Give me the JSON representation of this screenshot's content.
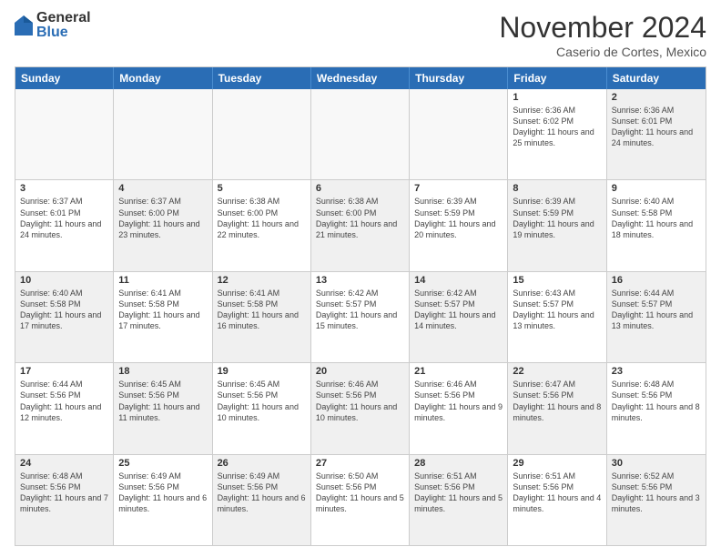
{
  "logo": {
    "general": "General",
    "blue": "Blue"
  },
  "header": {
    "title": "November 2024",
    "location": "Caserio de Cortes, Mexico"
  },
  "weekdays": [
    "Sunday",
    "Monday",
    "Tuesday",
    "Wednesday",
    "Thursday",
    "Friday",
    "Saturday"
  ],
  "rows": [
    [
      {
        "day": "",
        "info": "",
        "empty": true
      },
      {
        "day": "",
        "info": "",
        "empty": true
      },
      {
        "day": "",
        "info": "",
        "empty": true
      },
      {
        "day": "",
        "info": "",
        "empty": true
      },
      {
        "day": "",
        "info": "",
        "empty": true
      },
      {
        "day": "1",
        "info": "Sunrise: 6:36 AM\nSunset: 6:02 PM\nDaylight: 11 hours and 25 minutes.",
        "shade": false
      },
      {
        "day": "2",
        "info": "Sunrise: 6:36 AM\nSunset: 6:01 PM\nDaylight: 11 hours and 24 minutes.",
        "shade": true
      }
    ],
    [
      {
        "day": "3",
        "info": "Sunrise: 6:37 AM\nSunset: 6:01 PM\nDaylight: 11 hours and 24 minutes.",
        "shade": false
      },
      {
        "day": "4",
        "info": "Sunrise: 6:37 AM\nSunset: 6:00 PM\nDaylight: 11 hours and 23 minutes.",
        "shade": true
      },
      {
        "day": "5",
        "info": "Sunrise: 6:38 AM\nSunset: 6:00 PM\nDaylight: 11 hours and 22 minutes.",
        "shade": false
      },
      {
        "day": "6",
        "info": "Sunrise: 6:38 AM\nSunset: 6:00 PM\nDaylight: 11 hours and 21 minutes.",
        "shade": true
      },
      {
        "day": "7",
        "info": "Sunrise: 6:39 AM\nSunset: 5:59 PM\nDaylight: 11 hours and 20 minutes.",
        "shade": false
      },
      {
        "day": "8",
        "info": "Sunrise: 6:39 AM\nSunset: 5:59 PM\nDaylight: 11 hours and 19 minutes.",
        "shade": true
      },
      {
        "day": "9",
        "info": "Sunrise: 6:40 AM\nSunset: 5:58 PM\nDaylight: 11 hours and 18 minutes.",
        "shade": false
      }
    ],
    [
      {
        "day": "10",
        "info": "Sunrise: 6:40 AM\nSunset: 5:58 PM\nDaylight: 11 hours and 17 minutes.",
        "shade": true
      },
      {
        "day": "11",
        "info": "Sunrise: 6:41 AM\nSunset: 5:58 PM\nDaylight: 11 hours and 17 minutes.",
        "shade": false
      },
      {
        "day": "12",
        "info": "Sunrise: 6:41 AM\nSunset: 5:58 PM\nDaylight: 11 hours and 16 minutes.",
        "shade": true
      },
      {
        "day": "13",
        "info": "Sunrise: 6:42 AM\nSunset: 5:57 PM\nDaylight: 11 hours and 15 minutes.",
        "shade": false
      },
      {
        "day": "14",
        "info": "Sunrise: 6:42 AM\nSunset: 5:57 PM\nDaylight: 11 hours and 14 minutes.",
        "shade": true
      },
      {
        "day": "15",
        "info": "Sunrise: 6:43 AM\nSunset: 5:57 PM\nDaylight: 11 hours and 13 minutes.",
        "shade": false
      },
      {
        "day": "16",
        "info": "Sunrise: 6:44 AM\nSunset: 5:57 PM\nDaylight: 11 hours and 13 minutes.",
        "shade": true
      }
    ],
    [
      {
        "day": "17",
        "info": "Sunrise: 6:44 AM\nSunset: 5:56 PM\nDaylight: 11 hours and 12 minutes.",
        "shade": false
      },
      {
        "day": "18",
        "info": "Sunrise: 6:45 AM\nSunset: 5:56 PM\nDaylight: 11 hours and 11 minutes.",
        "shade": true
      },
      {
        "day": "19",
        "info": "Sunrise: 6:45 AM\nSunset: 5:56 PM\nDaylight: 11 hours and 10 minutes.",
        "shade": false
      },
      {
        "day": "20",
        "info": "Sunrise: 6:46 AM\nSunset: 5:56 PM\nDaylight: 11 hours and 10 minutes.",
        "shade": true
      },
      {
        "day": "21",
        "info": "Sunrise: 6:46 AM\nSunset: 5:56 PM\nDaylight: 11 hours and 9 minutes.",
        "shade": false
      },
      {
        "day": "22",
        "info": "Sunrise: 6:47 AM\nSunset: 5:56 PM\nDaylight: 11 hours and 8 minutes.",
        "shade": true
      },
      {
        "day": "23",
        "info": "Sunrise: 6:48 AM\nSunset: 5:56 PM\nDaylight: 11 hours and 8 minutes.",
        "shade": false
      }
    ],
    [
      {
        "day": "24",
        "info": "Sunrise: 6:48 AM\nSunset: 5:56 PM\nDaylight: 11 hours and 7 minutes.",
        "shade": true
      },
      {
        "day": "25",
        "info": "Sunrise: 6:49 AM\nSunset: 5:56 PM\nDaylight: 11 hours and 6 minutes.",
        "shade": false
      },
      {
        "day": "26",
        "info": "Sunrise: 6:49 AM\nSunset: 5:56 PM\nDaylight: 11 hours and 6 minutes.",
        "shade": true
      },
      {
        "day": "27",
        "info": "Sunrise: 6:50 AM\nSunset: 5:56 PM\nDaylight: 11 hours and 5 minutes.",
        "shade": false
      },
      {
        "day": "28",
        "info": "Sunrise: 6:51 AM\nSunset: 5:56 PM\nDaylight: 11 hours and 5 minutes.",
        "shade": true
      },
      {
        "day": "29",
        "info": "Sunrise: 6:51 AM\nSunset: 5:56 PM\nDaylight: 11 hours and 4 minutes.",
        "shade": false
      },
      {
        "day": "30",
        "info": "Sunrise: 6:52 AM\nSunset: 5:56 PM\nDaylight: 11 hours and 3 minutes.",
        "shade": true
      }
    ]
  ]
}
